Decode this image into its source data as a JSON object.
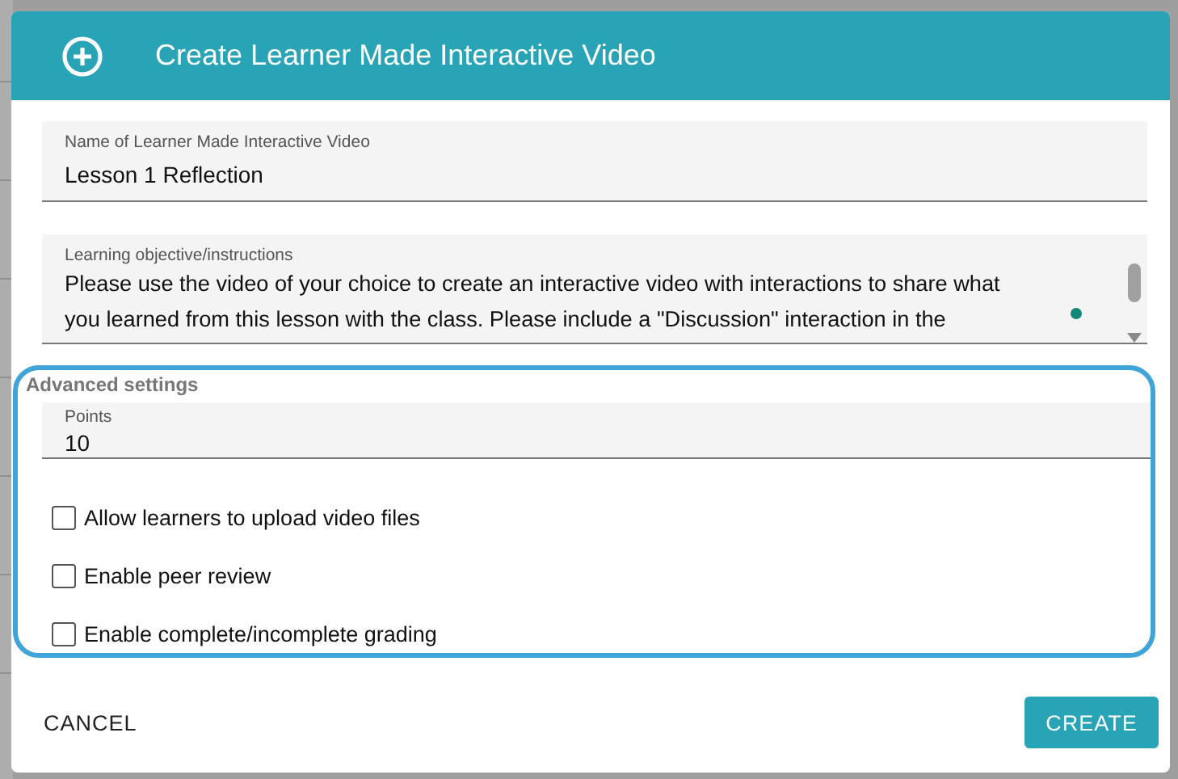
{
  "dialog": {
    "title": "Create Learner Made Interactive Video",
    "name_field": {
      "label": "Name of Learner Made Interactive Video",
      "value": "Lesson 1 Reflection"
    },
    "objective_field": {
      "label": "Learning objective/instructions",
      "lines": [
        "Please use the video of your choice to create an interactive video with interactions to share what",
        "you learned from this lesson with the class. Please include a \"Discussion\" interaction in the"
      ]
    },
    "advanced": {
      "heading": "Advanced settings",
      "points_field": {
        "label": "Points",
        "value": "10"
      },
      "options": [
        {
          "label": "Allow learners to upload video files",
          "checked": false
        },
        {
          "label": "Enable peer review",
          "checked": false
        },
        {
          "label": "Enable complete/incomplete grading",
          "checked": false
        }
      ]
    },
    "buttons": {
      "cancel": "CANCEL",
      "create": "CREATE"
    }
  }
}
